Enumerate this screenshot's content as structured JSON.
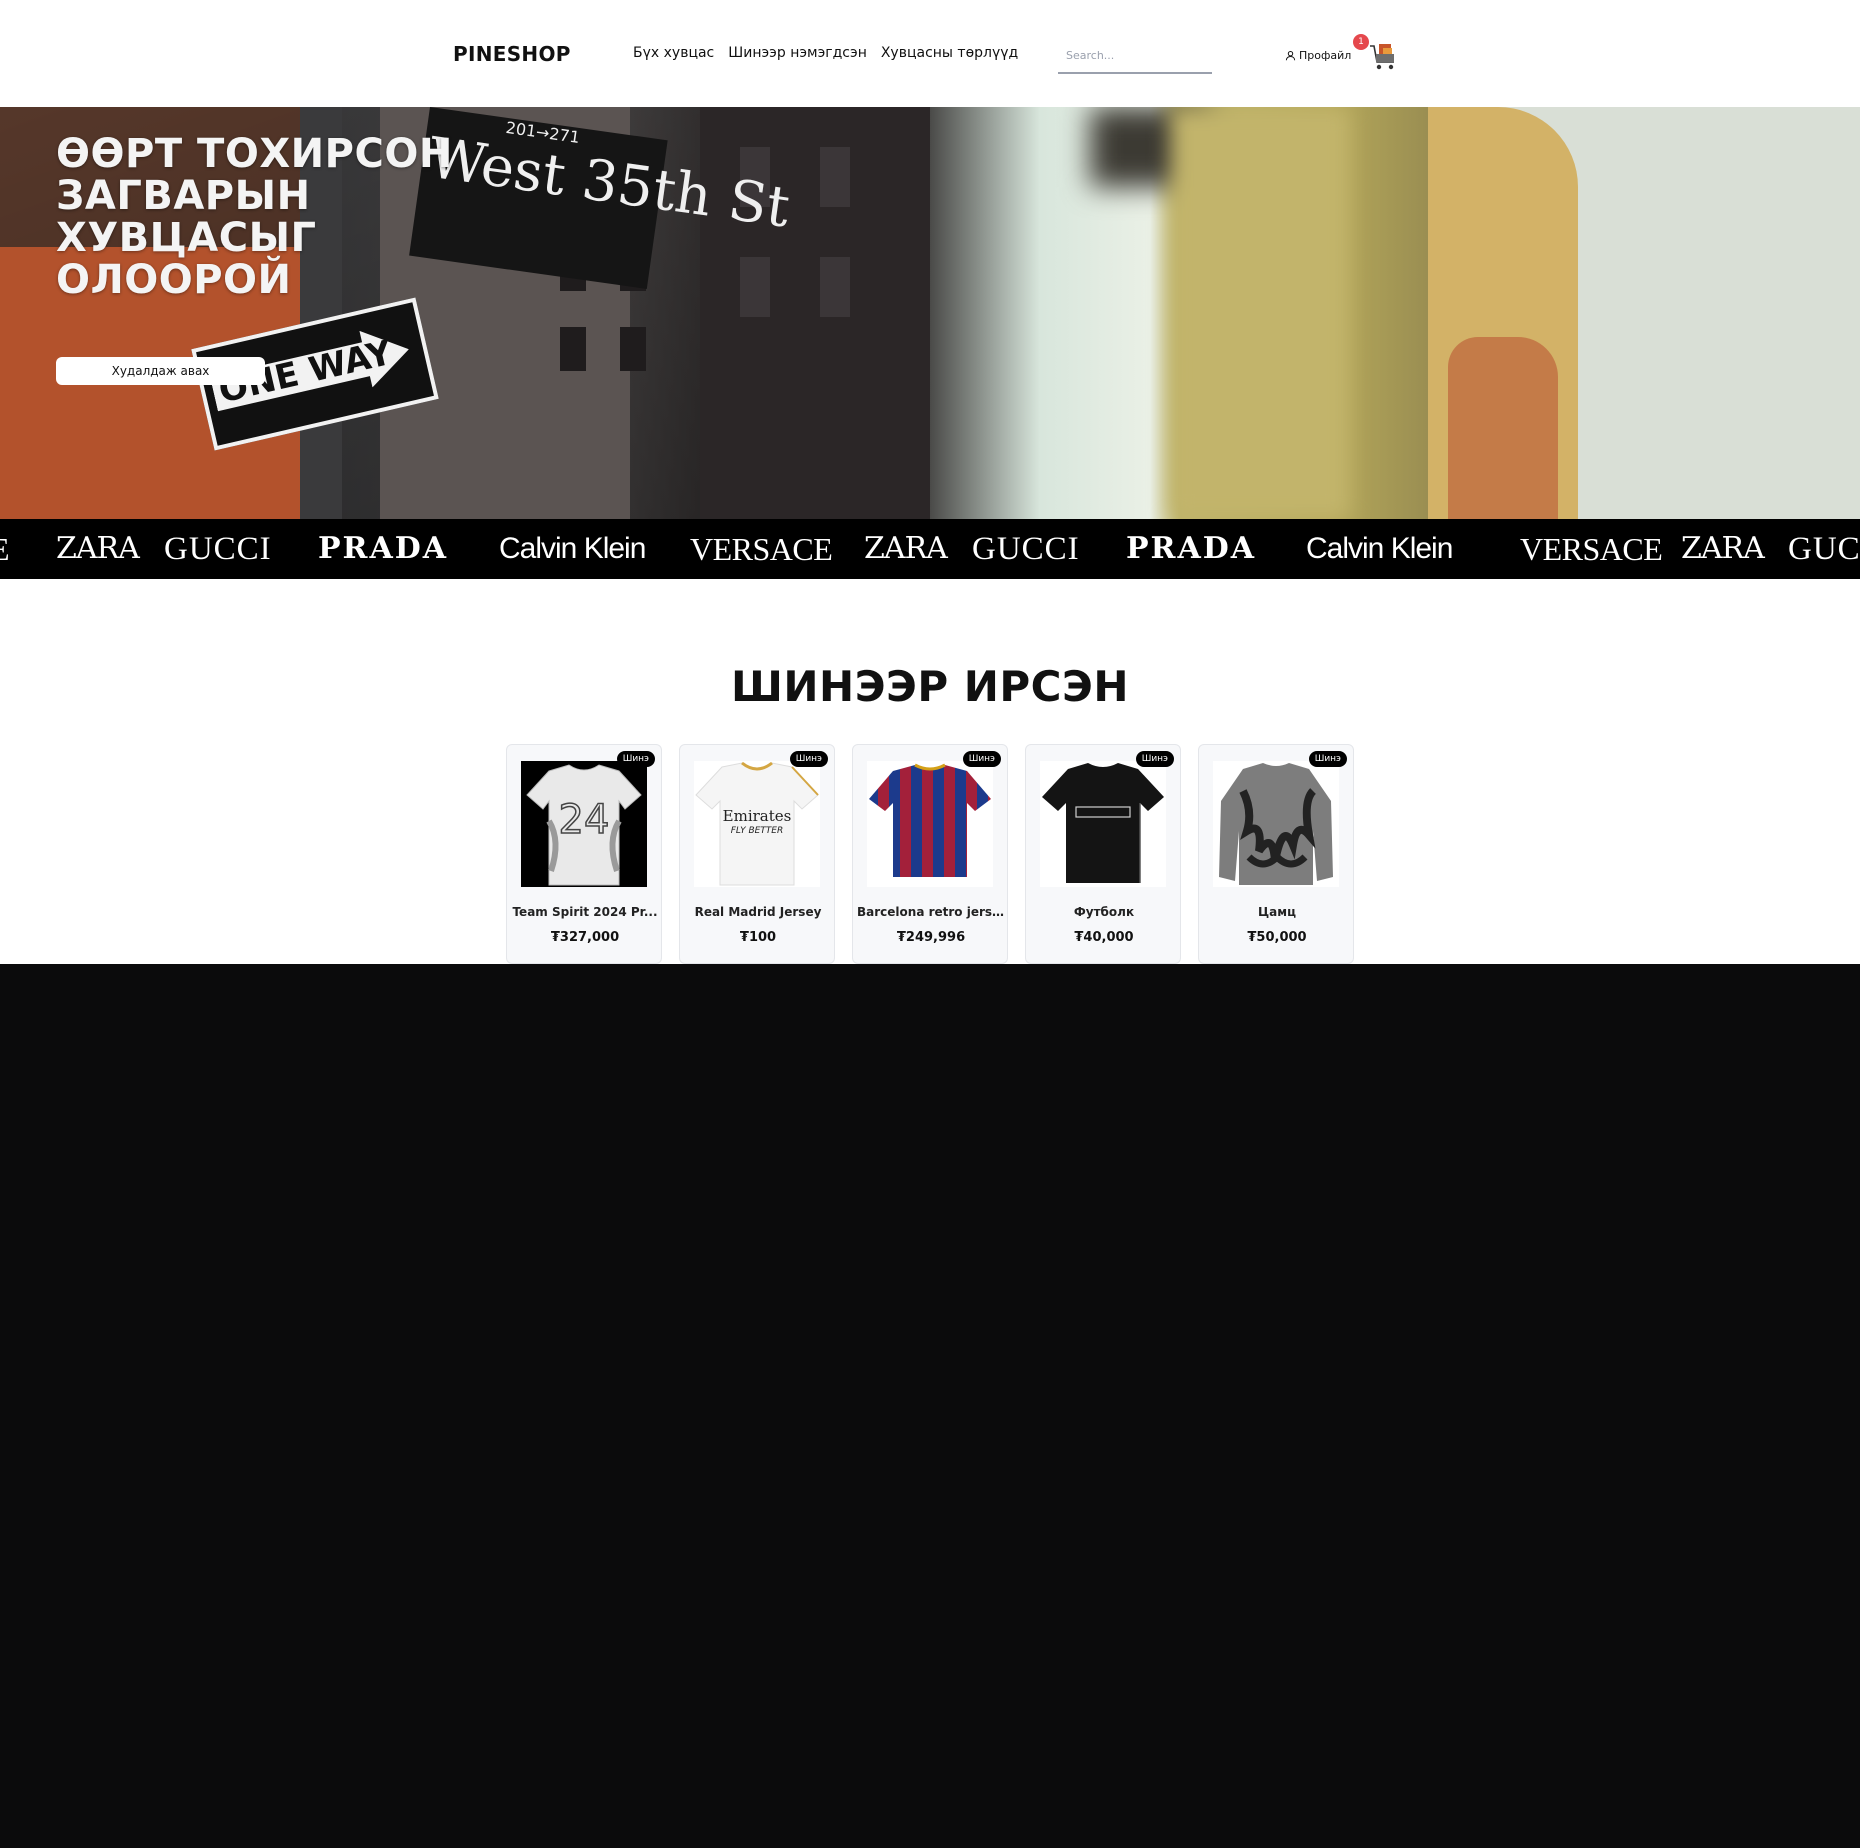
{
  "header": {
    "logo": "PINESHOP",
    "nav": [
      "Бүх хувцас",
      "Шинээр нэмэгдсэн",
      "Хувцасны төрлүүд"
    ],
    "search_placeholder": "Search...",
    "profile_label": "Профайл",
    "cart_count": "1"
  },
  "hero": {
    "title": "ӨӨРТ ТОХИРСОН\nЗАГВАРЫН\nХУВЦАСЫГ\nОЛООРОЙ",
    "button_label": "Худалдаж авах",
    "sign_street": "West 35th St",
    "sign_numbers": "201→271",
    "sign_oneway": "ONE WAY"
  },
  "brands": [
    "E",
    "ZARA",
    "GUCCI",
    "PRADA",
    "Calvin Klein",
    "VERSACE",
    "ZARA",
    "GUCCI",
    "PRADA",
    "Calvin Klein",
    "VERSACE",
    "ZARA",
    "GUCC"
  ],
  "new_arrivals": {
    "title": "ШИНЭЭР ИРСЭН",
    "products": [
      {
        "name": "Team Spirit 2024 Pr...",
        "price": "₮327,000",
        "badge": "Шинэ"
      },
      {
        "name": "Real Madrid Jersey",
        "price": "₮100",
        "badge": "Шинэ"
      },
      {
        "name": "Barcelona retro jers...",
        "price": "₮249,996",
        "badge": "Шинэ"
      },
      {
        "name": "Футболк",
        "price": "₮40,000",
        "badge": "Шинэ"
      },
      {
        "name": "Цамц",
        "price": "₮50,000",
        "badge": "Шинэ"
      }
    ]
  },
  "colors": {
    "badge_red": "#e5484d",
    "footer_bg": "#0b0b0c",
    "brand_strip": "#000000"
  }
}
